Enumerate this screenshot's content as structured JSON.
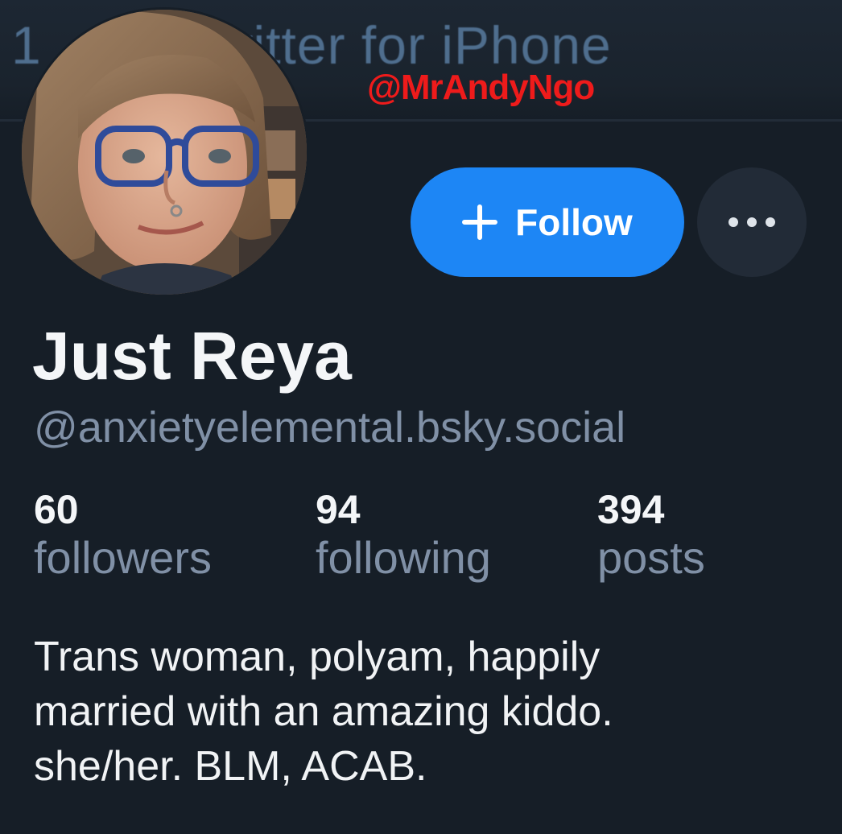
{
  "source_line": {
    "text": "1       · Twitter for iPhone"
  },
  "watermark": {
    "text": "@MrAndyNgo"
  },
  "profile": {
    "display_name": "Just Reya",
    "handle": "@anxietyelemental.bsky.social",
    "follow_label": "Follow",
    "stats": [
      {
        "count": "60",
        "label": "followers"
      },
      {
        "count": "94",
        "label": "following"
      },
      {
        "count": "394",
        "label": "posts"
      }
    ],
    "bio_lines": [
      "Trans woman, polyam, happily",
      "married with an amazing kiddo.",
      "she/her. BLM, ACAB."
    ]
  },
  "icons": {
    "follow": "plus-icon",
    "more": "ellipsis-icon",
    "avatar": "profile-photo"
  },
  "colors": {
    "background": "#161e27",
    "accent": "#1d86f5",
    "secondary_text": "#8090a6",
    "watermark": "#ee1b1b"
  }
}
